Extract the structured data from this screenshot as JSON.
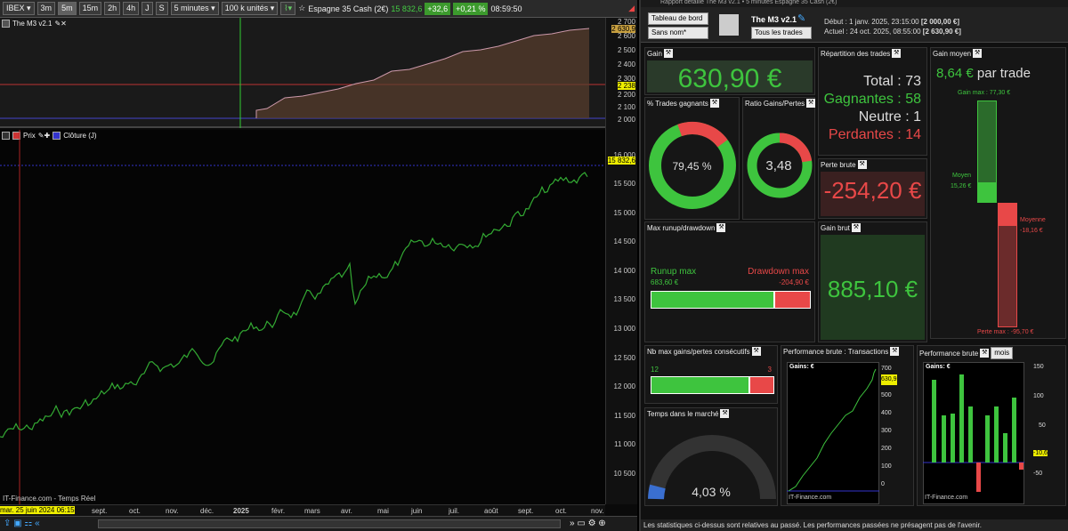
{
  "toolbar": {
    "instrument": "IBEX",
    "tf1": "3m",
    "tf2": "5m",
    "tf3": "15m",
    "tf4": "2h",
    "tf5": "4h",
    "tf6": "J",
    "tf7": "S",
    "period": "5 minutes",
    "units": "100 k unités",
    "name": "Espagne 35 Cash (2€)",
    "price": "15 832,6",
    "chg": "+32,6",
    "pct": "+0,21 %",
    "time": "08:59:50"
  },
  "ind": {
    "label": "The M3 v2.1",
    "axis": [
      "2 700",
      "2 630,9",
      "2 600",
      "2 500",
      "2 400",
      "2 300",
      "2 238",
      "2 200",
      "2 100",
      "2 000"
    ]
  },
  "price": {
    "label1": "Prix",
    "label2": "Clôture (J)",
    "axis": [
      "16 000",
      "15 832,6",
      "15 500",
      "15 000",
      "14 500",
      "14 000",
      "13 500",
      "13 000",
      "12 500",
      "12 000",
      "11 500",
      "11 000",
      "10 500"
    ],
    "watermark": "IT-Finance.com - Temps Réel"
  },
  "xaxis": {
    "cursor_date": "mar. 25 juin 2024 06:15",
    "labels": [
      "sept.",
      "oct.",
      "nov.",
      "déc.",
      "2025",
      "févr.",
      "mars",
      "avr.",
      "mai",
      "juin",
      "juil.",
      "août",
      "sept.",
      "oct.",
      "nov."
    ]
  },
  "report": {
    "titlebar": "Rapport détaillé   The M3 v2.1 • 5 minutes   Espagne 35 Cash (2€)",
    "view": "Tableau de bord",
    "filter": "Sans nom*",
    "strat": "The M3 v2.1",
    "trades": "Tous les trades",
    "debut_label": "Début :",
    "debut": "1 janv. 2025, 23:15:00",
    "debut_val": "[2 000,00 €]",
    "actuel_label": "Actuel :",
    "actuel": "24 oct. 2025, 08:55:00",
    "actuel_val": "[2 630,90 €]",
    "gain_t": "Gain",
    "gain": "630,90 €",
    "rep_t": "Répartition des trades",
    "total": "Total : 73",
    "gagn": "Gagnantes : 58",
    "neutre": "Neutre : 1",
    "perd": "Perdantes : 14",
    "gm_t": "Gain moyen",
    "gm": "8,64 €",
    "gm_s": "par trade",
    "gmax": "Gain max : 77,30 €",
    "moyen": "Moyen",
    "moyen_v": "15,26 €",
    "moyenne": "Moyenne",
    "moyenne_v": "-18,16 €",
    "pmax": "Perte max : -95,70 €",
    "pct_t": "% Trades gagnants",
    "pct": "79,45 %",
    "ratio_t": "Ratio Gains/Pertes",
    "ratio": "3,48",
    "pb_t": "Perte brute",
    "pb": "-254,20 €",
    "mr_t": "Max runup/drawdown",
    "ru": "Runup max",
    "ru_v": "683,60 €",
    "dd": "Drawdown max",
    "dd_v": "-204,90 €",
    "gb_t": "Gain brut",
    "gb": "885,10 €",
    "nb_t": "Nb max gains/pertes consécutifs",
    "nb_g": "12",
    "nb_p": "3",
    "perf_t": "Performance brute : Transactions",
    "perf_lbl": "Gains: €",
    "perf_axis": [
      "700",
      "630,9",
      "500",
      "400",
      "300",
      "200",
      "100",
      "0"
    ],
    "perf_wm": "IT-Finance.com",
    "pm_t": "Performance brute",
    "pm_sel": "mois",
    "pm_lbl": "Gains: €",
    "pm_axis": [
      "150",
      "100",
      "50",
      "-10,6",
      "-50"
    ],
    "pm_wm": "IT-Finance.com",
    "tm_t": "Temps dans le marché",
    "tm": "4,03 %",
    "footer": "Les statistiques ci-dessus sont relatives au passé. Les performances passées ne présagent pas de l'avenir."
  },
  "colors": {
    "green": "#3ec43e",
    "red": "#e84848"
  }
}
